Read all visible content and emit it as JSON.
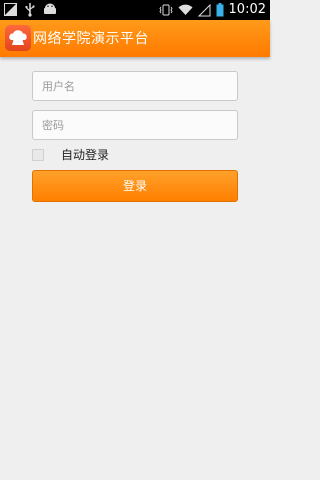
{
  "status_bar": {
    "time": "10:02",
    "icons": [
      "image-icon",
      "usb-icon",
      "android-icon",
      "vibrate-icon",
      "wifi-icon",
      "signal-icon",
      "battery-icon"
    ]
  },
  "app_bar": {
    "title": "网络学院演示平台",
    "logo_icon": "cloud-logo-icon",
    "color": "#ff8a00"
  },
  "form": {
    "username_placeholder": "用户名",
    "password_placeholder": "密码",
    "auto_login_label": "自动登录",
    "auto_login_checked": false,
    "login_button_label": "登录"
  },
  "colors": {
    "accent": "#ff8a00",
    "background": "#efefef"
  }
}
